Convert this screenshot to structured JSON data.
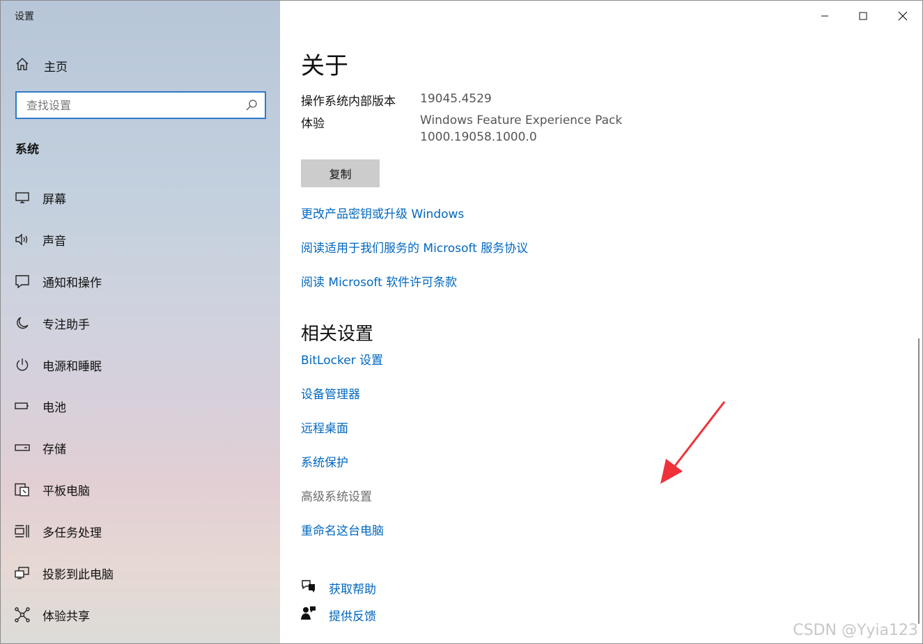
{
  "window": {
    "title": "设置"
  },
  "sidebar": {
    "home_label": "主页",
    "search_placeholder": "查找设置",
    "section_title": "系统",
    "items": [
      {
        "label": "屏幕",
        "icon": "monitor-icon"
      },
      {
        "label": "声音",
        "icon": "speaker-icon"
      },
      {
        "label": "通知和操作",
        "icon": "notification-icon"
      },
      {
        "label": "专注助手",
        "icon": "moon-icon"
      },
      {
        "label": "电源和睡眠",
        "icon": "power-icon"
      },
      {
        "label": "电池",
        "icon": "battery-icon"
      },
      {
        "label": "存储",
        "icon": "storage-icon"
      },
      {
        "label": "平板电脑",
        "icon": "tablet-icon"
      },
      {
        "label": "多任务处理",
        "icon": "multitask-icon"
      },
      {
        "label": "投影到此电脑",
        "icon": "project-icon"
      },
      {
        "label": "体验共享",
        "icon": "share-icon"
      }
    ]
  },
  "main": {
    "title": "关于",
    "info": [
      {
        "label": "操作系统内部版本",
        "value": "19045.4529"
      },
      {
        "label": "体验",
        "value_line1": "Windows Feature Experience Pack",
        "value_line2": "1000.19058.1000.0"
      }
    ],
    "copy_button": "复制",
    "links": [
      "更改产品密钥或升级 Windows",
      "阅读适用于我们服务的 Microsoft 服务协议",
      "阅读 Microsoft 软件许可条款"
    ],
    "related_title": "相关设置",
    "related_links": [
      {
        "label": "BitLocker 设置",
        "enabled": true
      },
      {
        "label": "设备管理器",
        "enabled": true
      },
      {
        "label": "远程桌面",
        "enabled": true
      },
      {
        "label": "系统保护",
        "enabled": true
      },
      {
        "label": "高级系统设置",
        "enabled": false
      },
      {
        "label": "重命名这台电脑",
        "enabled": true
      }
    ],
    "help": [
      {
        "label": "获取帮助",
        "icon": "help-chat-icon"
      },
      {
        "label": "提供反馈",
        "icon": "feedback-icon"
      }
    ]
  },
  "watermark": "CSDN @Yyia123",
  "colors": {
    "link": "#0067c0",
    "accent": "#2f79c9",
    "annotation_arrow": "#f0313a"
  }
}
